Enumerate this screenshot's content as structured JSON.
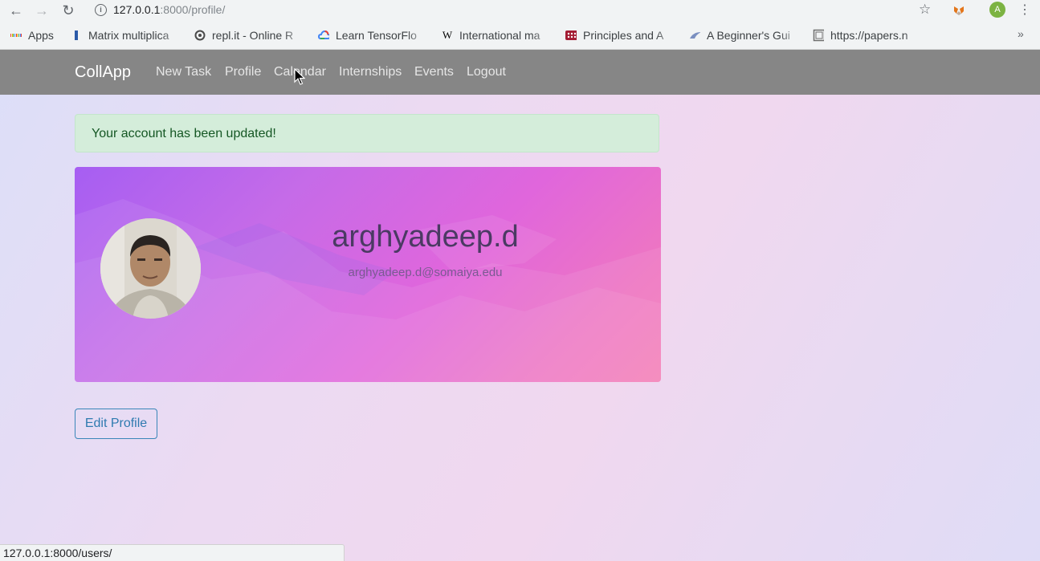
{
  "browser": {
    "url_host": "127.0.0.1",
    "url_path": ":8000/profile/",
    "profile_initial": "A",
    "bookmarks": [
      {
        "label": "Apps",
        "icon": "apps-grid-icon"
      },
      {
        "label": "Matrix multiplica",
        "icon": "bookmark-favicon-icon"
      },
      {
        "label": "repl.it - Online R",
        "icon": "replit-icon"
      },
      {
        "label": "Learn TensorFlo",
        "icon": "google-cloud-icon"
      },
      {
        "label": "International ma",
        "icon": "wikipedia-icon"
      },
      {
        "label": "Principles and A",
        "icon": "book-favicon-icon"
      },
      {
        "label": "A Beginner's Gui",
        "icon": "bookmark-favicon-icon"
      },
      {
        "label": "https://papers.n",
        "icon": "page-icon"
      }
    ],
    "status_url": "127.0.0.1:8000/users/"
  },
  "navbar": {
    "brand": "CollApp",
    "links": [
      "New Task",
      "Profile",
      "Calendar",
      "Internships",
      "Events",
      "Logout"
    ]
  },
  "alert": {
    "message": "Your account has been updated!",
    "color": "#d4edda"
  },
  "profile": {
    "username": "arghyadeep.d",
    "email": "arghyadeep.d@somaiya.edu"
  },
  "actions": {
    "edit_label": "Edit Profile"
  }
}
